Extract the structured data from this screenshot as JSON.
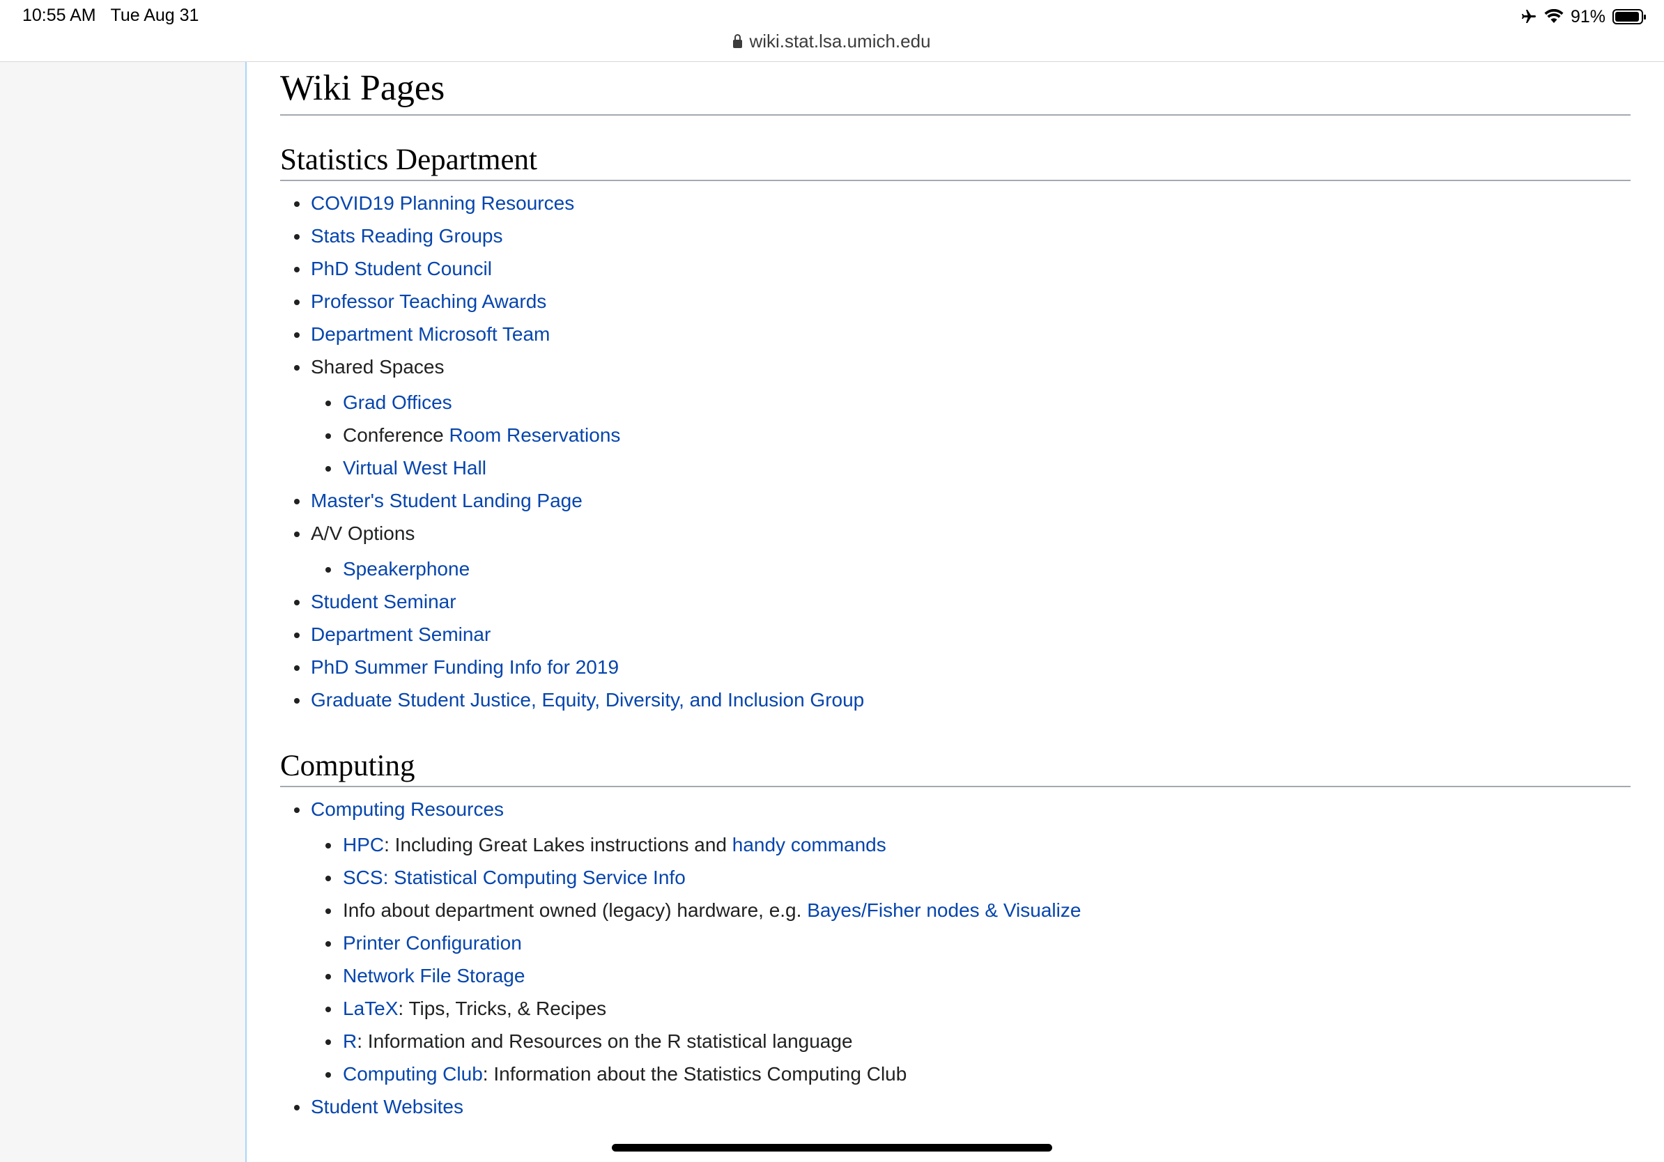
{
  "status_bar": {
    "time": "10:55 AM",
    "date": "Tue Aug 31",
    "battery": "91%",
    "url": "wiki.stat.lsa.umich.edu"
  },
  "page": {
    "title": "Wiki Pages",
    "sections": [
      {
        "heading": "Statistics Department",
        "items": [
          {
            "link": "COVID19 Planning Resources"
          },
          {
            "link": "Stats Reading Groups"
          },
          {
            "link": "PhD Student Council"
          },
          {
            "link": "Professor Teaching Awards"
          },
          {
            "link": "Department Microsoft Team"
          },
          {
            "text": "Shared Spaces",
            "children": [
              {
                "link": "Grad Offices"
              },
              {
                "prefix": "Conference ",
                "link": "Room Reservations"
              },
              {
                "link": "Virtual West Hall"
              }
            ]
          },
          {
            "link": "Master's Student Landing Page"
          },
          {
            "text": "A/V Options",
            "children": [
              {
                "link": "Speakerphone"
              }
            ]
          },
          {
            "link": "Student Seminar"
          },
          {
            "link": "Department Seminar"
          },
          {
            "link": "PhD Summer Funding Info for 2019"
          },
          {
            "link": "Graduate Student Justice, Equity, Diversity, and Inclusion Group"
          }
        ]
      },
      {
        "heading": "Computing",
        "items": [
          {
            "link": "Computing Resources",
            "children": [
              {
                "link": "HPC",
                "middle": ": Including Great Lakes instructions and ",
                "link2": "handy commands"
              },
              {
                "link": "SCS: Statistical Computing Service Info"
              },
              {
                "prefix": "Info about department owned (legacy) hardware, e.g. ",
                "link": "Bayes/Fisher nodes & Visualize"
              },
              {
                "link": "Printer Configuration"
              },
              {
                "link": "Network File Storage"
              },
              {
                "link": "LaTeX",
                "middle": ": Tips, Tricks, & Recipes"
              },
              {
                "link": "R",
                "middle": ": Information and Resources on the R statistical language"
              },
              {
                "link": "Computing Club",
                "middle": ": Information about the Statistics Computing Club"
              }
            ]
          },
          {
            "link": "Student Websites"
          }
        ]
      }
    ]
  }
}
